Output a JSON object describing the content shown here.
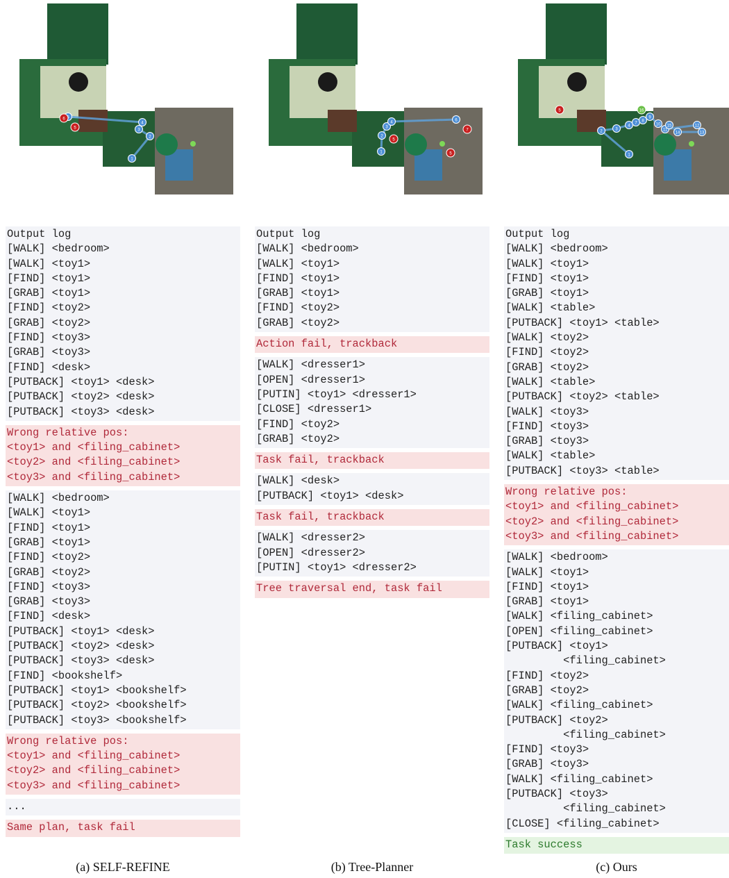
{
  "panels": [
    {
      "caption": "(a) SELF-REFINE",
      "blocks": [
        {
          "kind": "neutral",
          "lines": [
            "Output log",
            "[WALK] <bedroom>",
            "[WALK] <toy1>",
            "[FIND] <toy1>",
            "[GRAB] <toy1>",
            "[FIND] <toy2>",
            "[GRAB] <toy2>",
            "[FIND] <toy3>",
            "[GRAB] <toy3>",
            "[FIND] <desk>",
            "[PUTBACK] <toy1> <desk>",
            "[PUTBACK] <toy2> <desk>",
            "[PUTBACK] <toy3> <desk>"
          ]
        },
        {
          "kind": "fail",
          "lines": [
            "Wrong relative pos:",
            "<toy1> and <filing_cabinet>",
            "<toy2> and <filing_cabinet>",
            "<toy3> and <filing_cabinet>"
          ]
        },
        {
          "kind": "neutral",
          "lines": [
            "[WALK] <bedroom>",
            "[WALK] <toy1>",
            "[FIND] <toy1>",
            "[GRAB] <toy1>",
            "[FIND] <toy2>",
            "[GRAB] <toy2>",
            "[FIND] <toy3>",
            "[GRAB] <toy3>",
            "[FIND] <desk>",
            "[PUTBACK] <toy1> <desk>",
            "[PUTBACK] <toy2> <desk>",
            "[PUTBACK] <toy3> <desk>",
            "[FIND] <bookshelf>",
            "[PUTBACK] <toy1> <bookshelf>",
            "[PUTBACK] <toy2> <bookshelf>",
            "[PUTBACK] <toy3> <bookshelf>"
          ]
        },
        {
          "kind": "fail",
          "lines": [
            "Wrong relative pos:",
            "<toy1> and <filing_cabinet>",
            "<toy2> and <filing_cabinet>",
            "<toy3> and <filing_cabinet>"
          ]
        },
        {
          "kind": "neutral",
          "lines": [
            "..."
          ]
        },
        {
          "kind": "fail",
          "lines": [
            "Same plan, task fail"
          ]
        }
      ],
      "markers": {
        "blue": [
          "1",
          "2",
          "3",
          "4",
          "5"
        ],
        "red": [
          "6",
          "5"
        ]
      }
    },
    {
      "caption": "(b) Tree-Planner",
      "blocks": [
        {
          "kind": "neutral",
          "lines": [
            "Output log",
            "[WALK] <bedroom>",
            "[WALK] <toy1>",
            "[FIND] <toy1>",
            "[GRAB] <toy1>",
            "[FIND] <toy2>",
            "[GRAB] <toy2>"
          ]
        },
        {
          "kind": "fail",
          "lines": [
            "Action fail, trackback"
          ]
        },
        {
          "kind": "neutral",
          "lines": [
            "[WALK] <dresser1>",
            "[OPEN] <dresser1>",
            "[PUTIN] <toy1> <dresser1>",
            "[CLOSE] <dresser1>",
            "[FIND] <toy2>",
            "[GRAB] <toy2>"
          ]
        },
        {
          "kind": "fail",
          "lines": [
            "Task fail, trackback"
          ]
        },
        {
          "kind": "neutral",
          "lines": [
            "[WALK] <desk>",
            "[PUTBACK] <toy1> <desk>"
          ]
        },
        {
          "kind": "fail",
          "lines": [
            "Task fail, trackback"
          ]
        },
        {
          "kind": "neutral",
          "lines": [
            "[WALK] <dresser2>",
            "[OPEN] <dresser2>",
            "[PUTIN] <toy1> <dresser2>"
          ]
        },
        {
          "kind": "fail",
          "lines": [
            "Tree traversal end, task fail"
          ]
        }
      ],
      "markers": {
        "blue": [
          "1",
          "2",
          "3",
          "4",
          "6"
        ],
        "red": [
          "5",
          "7",
          "5"
        ]
      }
    },
    {
      "caption": "(c) Ours",
      "blocks": [
        {
          "kind": "neutral",
          "lines": [
            "Output log",
            "[WALK] <bedroom>",
            "[WALK] <toy1>",
            "[FIND] <toy1>",
            "[GRAB] <toy1>",
            "[WALK] <table>",
            "[PUTBACK] <toy1> <table>",
            "[WALK] <toy2>",
            "[FIND] <toy2>",
            "[GRAB] <toy2>",
            "[WALK] <table>",
            "[PUTBACK] <toy2> <table>",
            "[WALK] <toy3>",
            "[FIND] <toy3>",
            "[GRAB] <toy3>",
            "[WALK] <table>",
            "[PUTBACK] <toy3> <table>"
          ]
        },
        {
          "kind": "fail",
          "lines": [
            "Wrong relative pos:",
            "<toy1> and <filing_cabinet>",
            "<toy2> and <filing_cabinet>",
            "<toy3> and <filing_cabinet>"
          ]
        },
        {
          "kind": "neutral",
          "lines": [
            "[WALK] <bedroom>",
            "[WALK] <toy1>",
            "[FIND] <toy1>",
            "[GRAB] <toy1>",
            "[WALK] <filing_cabinet>",
            "[OPEN] <filing_cabinet>",
            "[PUTBACK] <toy1>",
            "         <filing_cabinet>",
            "[FIND] <toy2>",
            "[GRAB] <toy2>",
            "[WALK] <filing_cabinet>",
            "[PUTBACK] <toy2>",
            "         <filing_cabinet>",
            "[FIND] <toy3>",
            "[GRAB] <toy3>",
            "[WALK] <filing_cabinet>",
            "[PUTBACK] <toy3>",
            "         <filing_cabinet>",
            "[CLOSE] <filing_cabinet>"
          ]
        },
        {
          "kind": "success",
          "lines": [
            "Task success"
          ]
        }
      ],
      "markers": {
        "blue": [
          "1",
          "2",
          "3",
          "4",
          "7",
          "8",
          "9",
          "10",
          "11",
          "12",
          "13",
          "14",
          "15"
        ],
        "red": [
          "5"
        ],
        "green": [
          "16"
        ]
      }
    }
  ]
}
